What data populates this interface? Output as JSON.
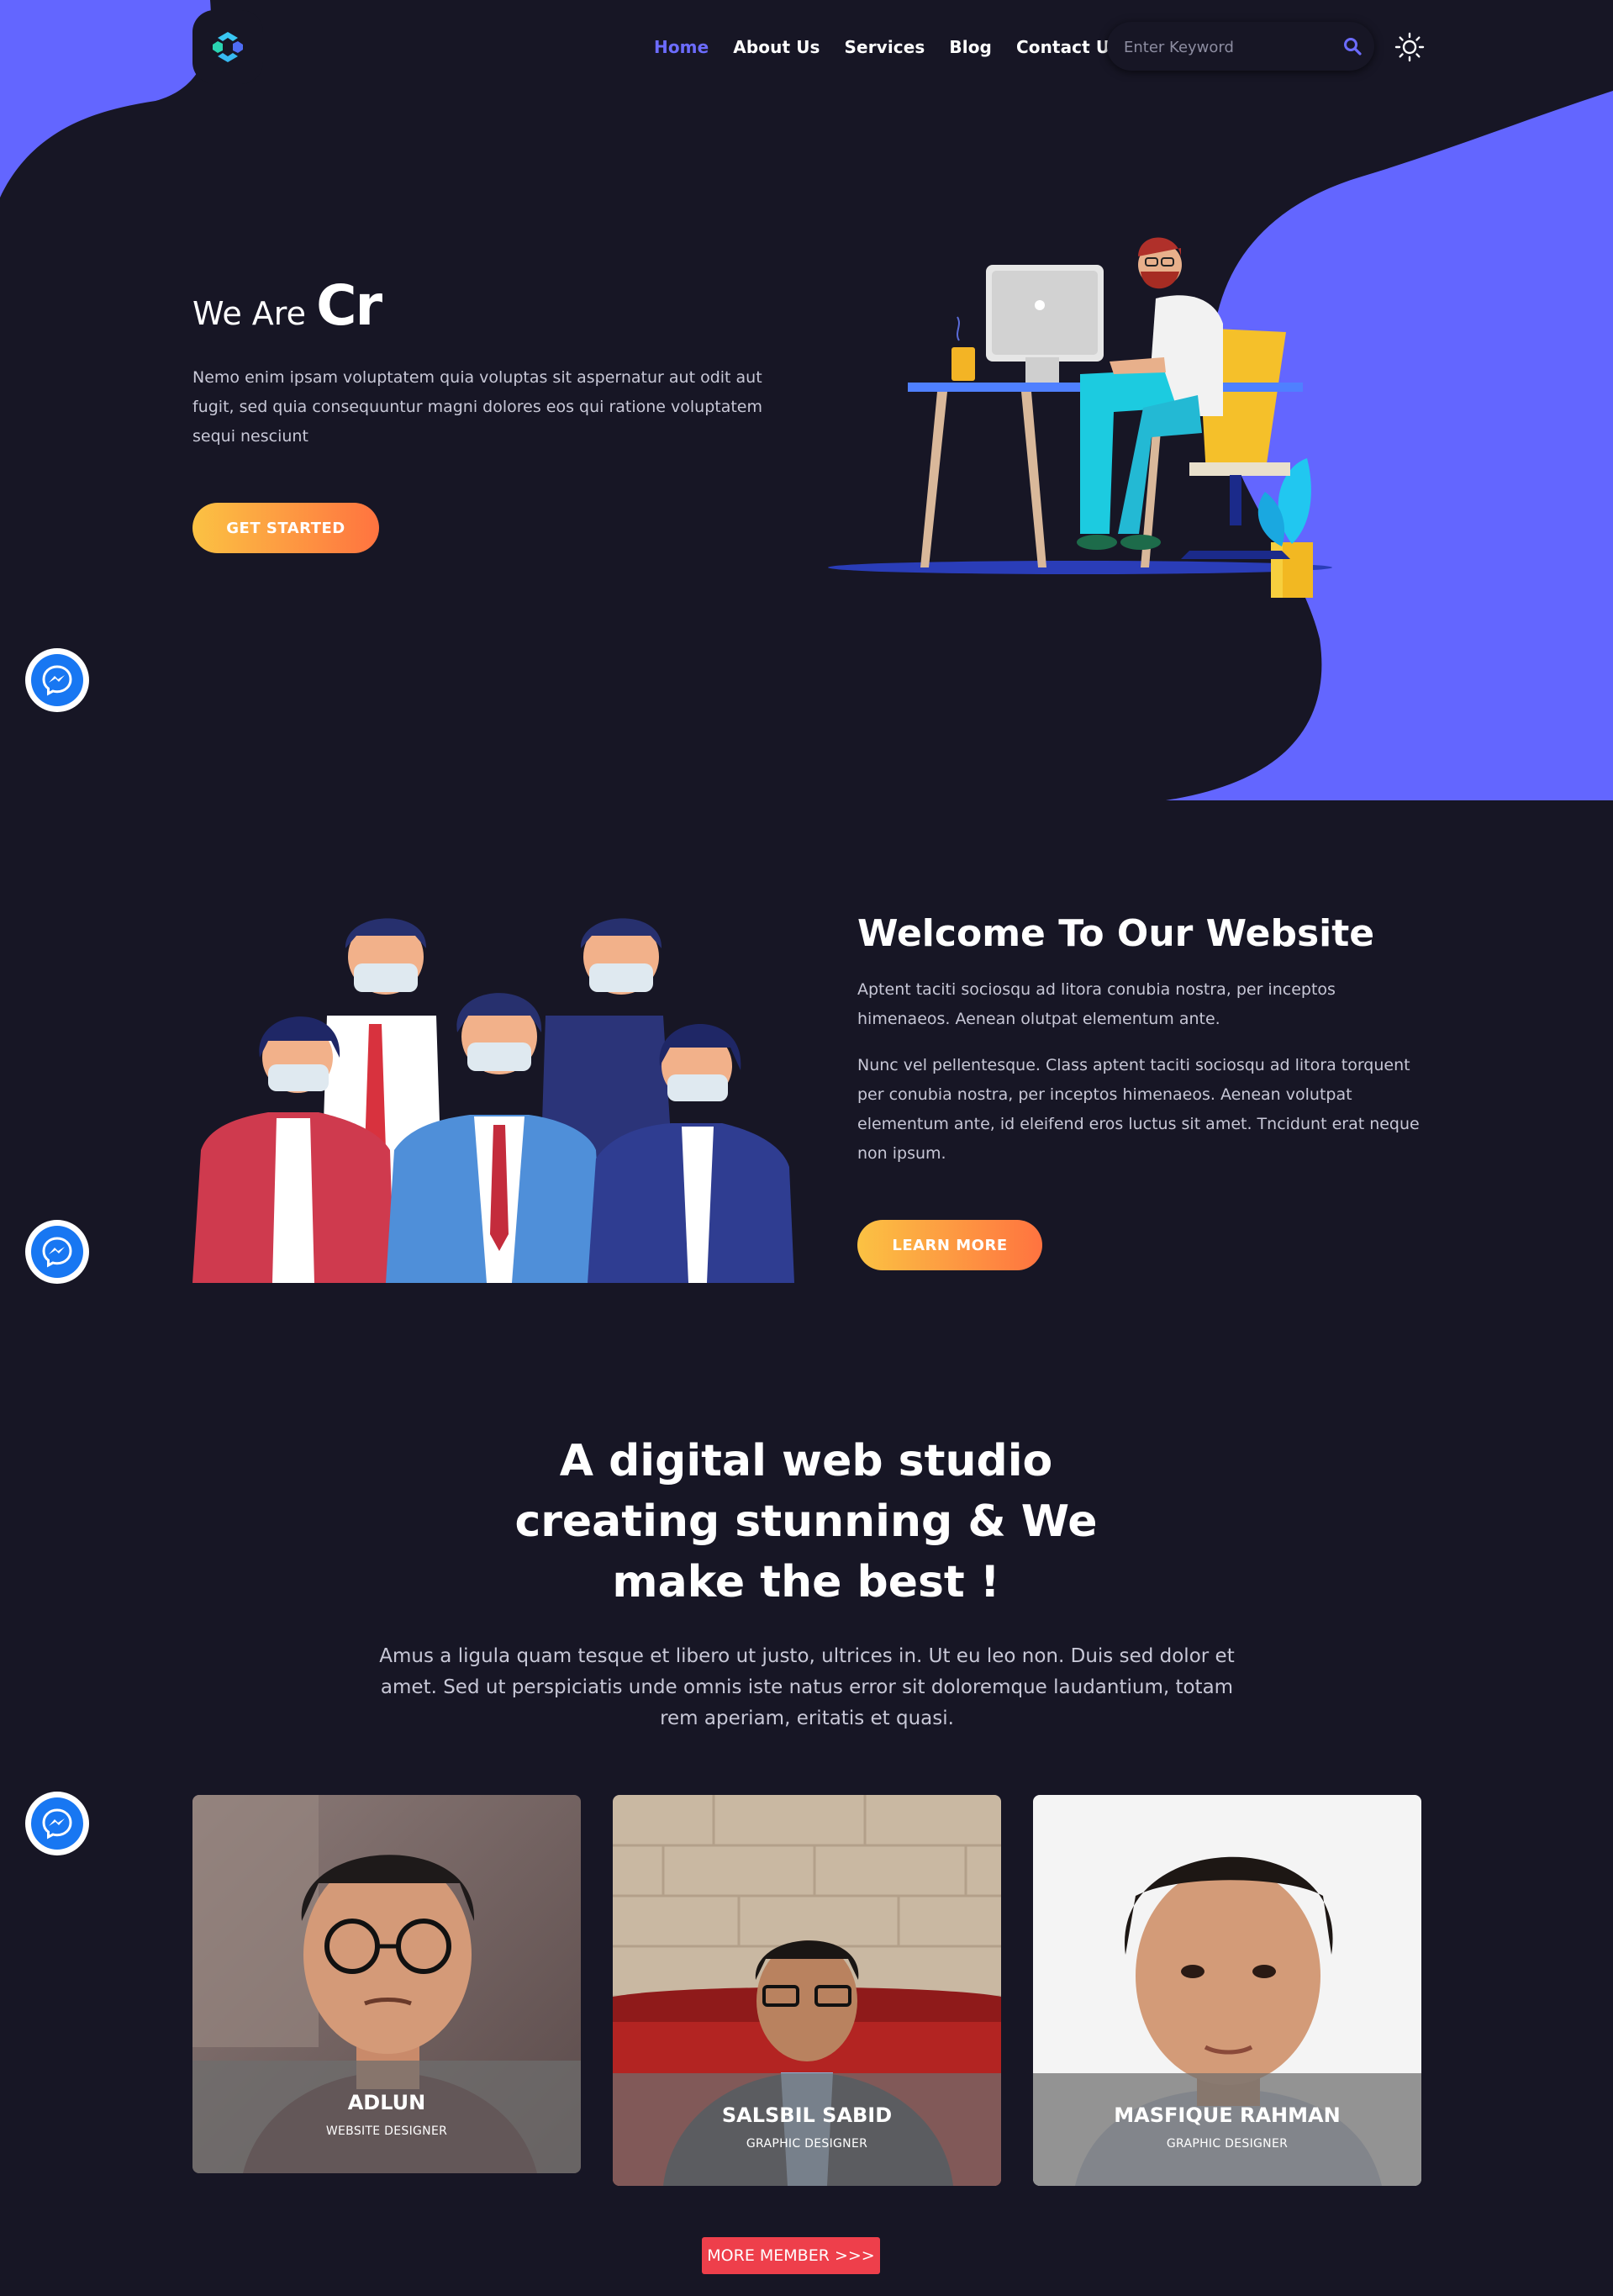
{
  "nav": {
    "items": [
      {
        "label": "Home",
        "active": true
      },
      {
        "label": "About Us",
        "active": false
      },
      {
        "label": "Services",
        "active": false
      },
      {
        "label": "Blog",
        "active": false
      },
      {
        "label": "Contact Us",
        "active": false
      }
    ],
    "search_placeholder": "Enter Keyword"
  },
  "hero": {
    "title_prefix": "We Are",
    "title_typed": "Cr",
    "description": "Nemo enim ipsam voluptatem quia voluptas sit aspernatur aut odit aut fugit, sed quia consequuntur magni dolores eos qui ratione voluptatem sequi nesciunt",
    "cta": "GET STARTED"
  },
  "welcome": {
    "title": "Welcome To Our Website",
    "p1": "Aptent taciti sociosqu ad litora conubia nostra, per inceptos himenaeos. Aenean olutpat elementum ante.",
    "p2": "Nunc vel pellentesque. Class aptent taciti sociosqu ad litora torquent per conubia nostra, per inceptos himenaeos. Aenean volutpat elementum ante, id eleifend eros luctus sit amet. Tncidunt erat neque non ipsum.",
    "cta": "LEARN MORE"
  },
  "studio": {
    "title": "A digital web studio creating stunning & We make the best !",
    "description": "Amus a ligula quam tesque et libero ut justo, ultrices in. Ut eu leo non. Duis sed dolor et amet. Sed ut perspiciatis unde omnis iste natus error sit doloremque laudantium, totam rem aperiam, eritatis et quasi."
  },
  "team": [
    {
      "name": "ADLUN",
      "role": "WEBSITE DESIGNER"
    },
    {
      "name": "SALSBIL SABID",
      "role": "GRAPHIC DESIGNER"
    },
    {
      "name": "MASFIQUE RAHMAN",
      "role": "GRAPHIC DESIGNER"
    }
  ],
  "more_button": "MORE MEMBER >>>",
  "colors": {
    "background": "#171625",
    "accent": "#6c6cff",
    "blob": "#6366ff",
    "cta_gradient_start": "#fbc243",
    "cta_gradient_end": "#ff7340",
    "more_button": "#ee3f4b",
    "messenger": "#1877f2"
  },
  "icons": [
    "logo-icon",
    "search-icon",
    "sun-icon",
    "messenger-icon"
  ]
}
